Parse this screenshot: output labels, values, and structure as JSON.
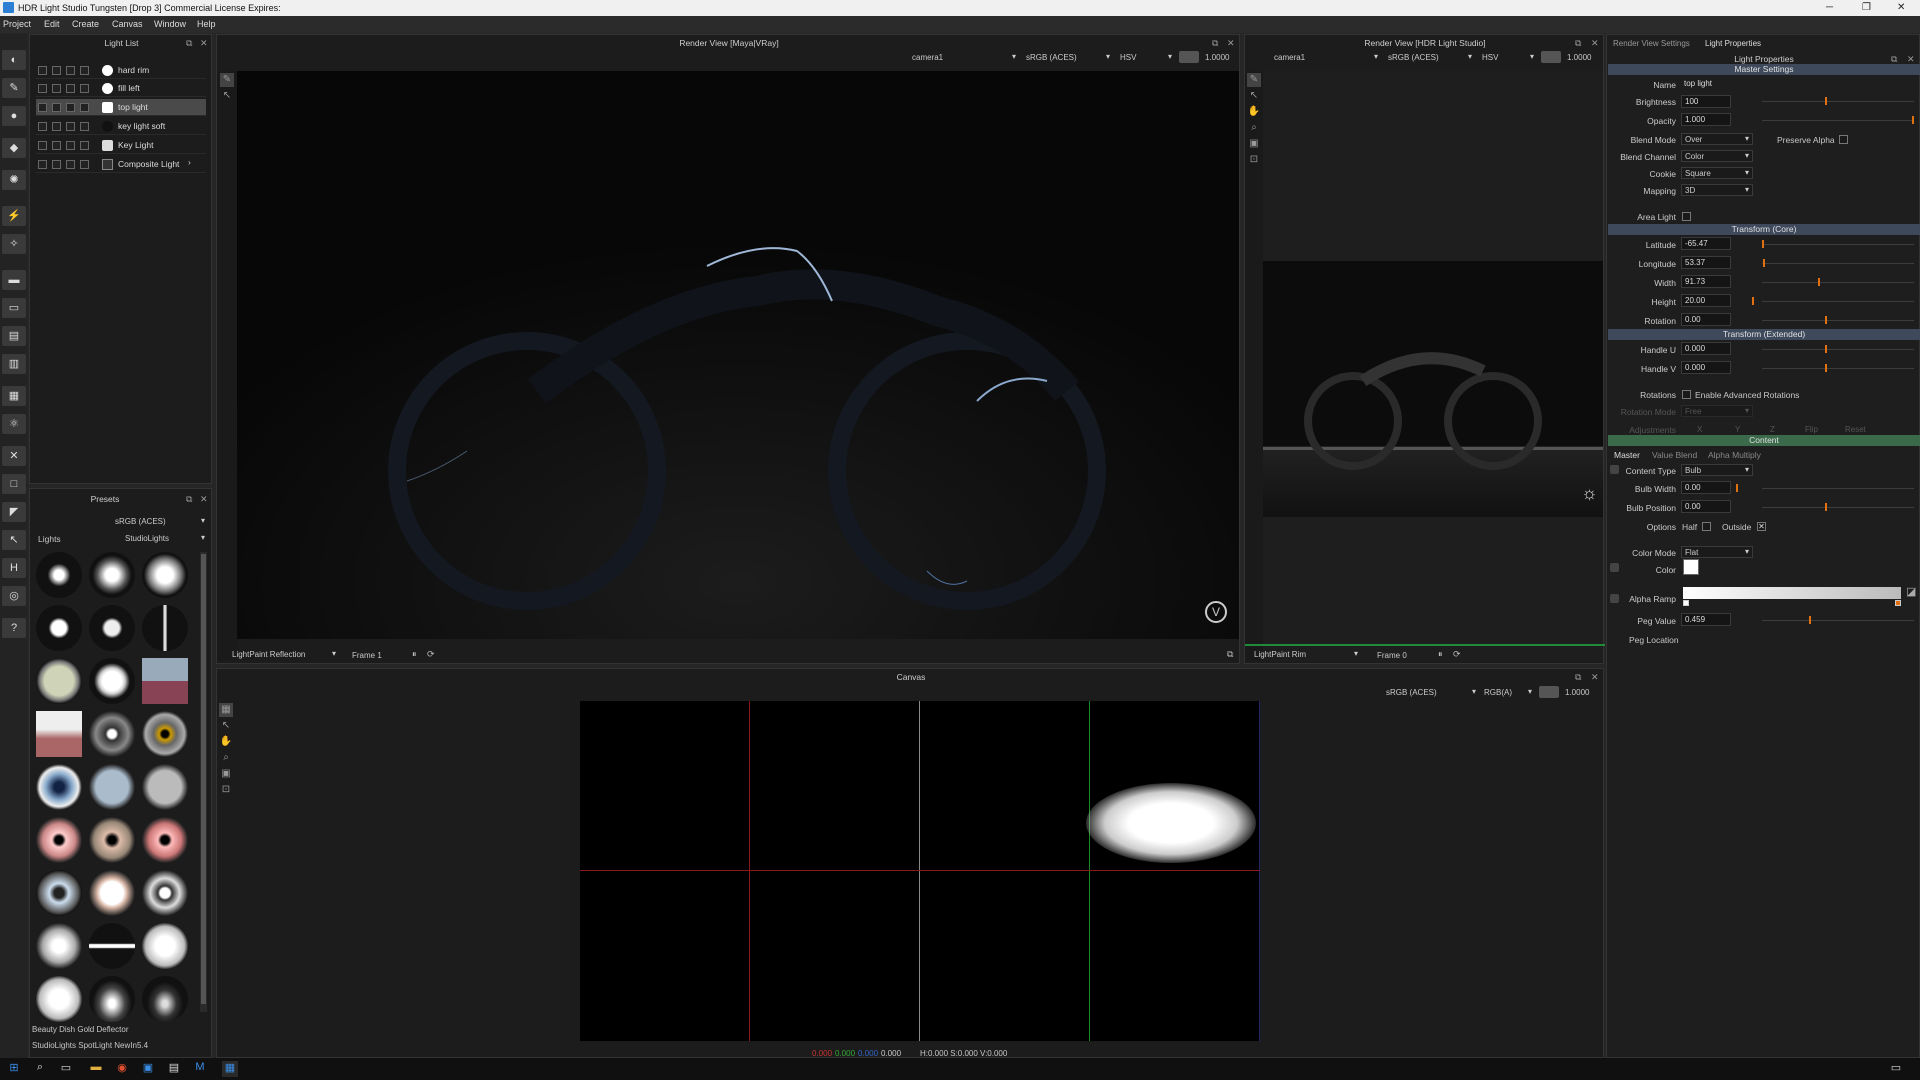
{
  "window": {
    "title": "HDR Light Studio Tungsten [Drop 3] Commercial License Expires:",
    "min": "─",
    "max": "❐",
    "close": "✕"
  },
  "menu": [
    "Project",
    "Edit",
    "Create",
    "Canvas",
    "Window",
    "Help"
  ],
  "light_list": {
    "title": "Light List",
    "items": [
      {
        "label": "hard rim"
      },
      {
        "label": "fill left"
      },
      {
        "label": "top light",
        "selected": true
      },
      {
        "label": "key light soft"
      },
      {
        "label": "Key Light"
      },
      {
        "label": "Composite Light"
      }
    ]
  },
  "presets": {
    "title": "Presets",
    "colorspace": "sRGB (ACES)",
    "category": "Lights",
    "library": "StudioLights",
    "footer1": "Beauty Dish Gold Deflector",
    "footer2": "StudioLights SpotLight NewIn5.4"
  },
  "render_main": {
    "title": "Render View [Maya|VRay]",
    "camera": "camera1",
    "colorspace": "sRGB (ACES)",
    "mode": "HSV",
    "exposure": "1.0000",
    "paint_mode": "LightPaint Reflection",
    "frame": "Frame 1"
  },
  "render_hdr": {
    "title": "Render View [HDR Light Studio]",
    "camera": "camera1",
    "colorspace": "sRGB (ACES)",
    "mode": "HSV",
    "exposure": "1.0000",
    "paint_mode": "LightPaint Rim",
    "frame": "Frame 0"
  },
  "canvas": {
    "title": "Canvas",
    "colorspace": "sRGB (ACES)",
    "channel": "RGB(A)",
    "exposure": "1.0000",
    "rgb_r": "0.000",
    "rgb_g": "0.000",
    "rgb_b": "0.000",
    "rgb_a": "0.000",
    "hsv": "H:0.000 S:0.000 V:0.000"
  },
  "props": {
    "tab1": "Render View Settings",
    "tab2": "Light Properties",
    "title": "Light Properties",
    "sec_master": "Master Settings",
    "name_label": "Name",
    "name": "top light",
    "brightness_label": "Brightness",
    "brightness": "100",
    "opacity_label": "Opacity",
    "opacity": "1.000",
    "blend_mode_label": "Blend Mode",
    "blend_mode": "Over",
    "preserve_alpha": "Preserve Alpha",
    "blend_channel_label": "Blend Channel",
    "blend_channel": "Color",
    "cookie_label": "Cookie",
    "cookie": "Square",
    "mapping_label": "Mapping",
    "mapping": "3D",
    "area_light": "Area Light",
    "sec_core": "Transform (Core)",
    "lat_label": "Latitude",
    "lat": "-65.47",
    "lon_label": "Longitude",
    "lon": "53.37",
    "width_label": "Width",
    "width": "91.73",
    "height_label": "Height",
    "height": "20.00",
    "rot_label": "Rotation",
    "rot": "0.00",
    "sec_ext": "Transform (Extended)",
    "hu_label": "Handle U",
    "hu": "0.000",
    "hv_label": "Handle V",
    "hv": "0.000",
    "rotations_label": "Rotations",
    "adv_rot": "Enable Advanced Rotations",
    "rot_mode_label": "Rotation Mode",
    "rot_mode": "Free",
    "adj_label": "Adjustments",
    "adj_x": "X",
    "adj_y": "Y",
    "adj_z": "Z",
    "flip": "Flip",
    "reset": "Reset",
    "sec_content": "Content",
    "ctab_master": "Master",
    "ctab_value": "Value Blend",
    "ctab_alpha": "Alpha Multiply",
    "ctype_label": "Content Type",
    "ctype": "Bulb",
    "bw_label": "Bulb Width",
    "bw": "0.00",
    "bp_label": "Bulb Position",
    "bp": "0.00",
    "options_label": "Options",
    "half": "Half",
    "outside": "Outside",
    "cmode_label": "Color Mode",
    "cmode": "Flat",
    "color_label": "Color",
    "aramp_label": "Alpha Ramp",
    "peg_label": "Peg Value",
    "peg": "0.459",
    "pegloc_label": "Peg Location"
  }
}
